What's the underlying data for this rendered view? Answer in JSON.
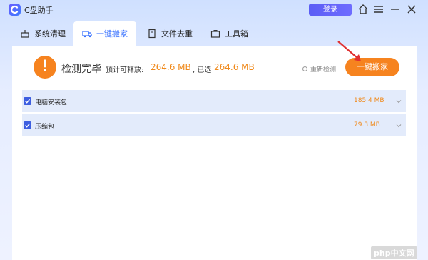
{
  "app": {
    "title": "C盘助手",
    "login_label": "登录"
  },
  "tabs": [
    {
      "label": "系统清理",
      "icon": "broom-icon"
    },
    {
      "label": "一键搬家",
      "icon": "truck-icon",
      "active": true
    },
    {
      "label": "文件去重",
      "icon": "file-icon"
    },
    {
      "label": "工具箱",
      "icon": "toolbox-icon"
    }
  ],
  "banner": {
    "status": "检测完毕",
    "release_label": "预计可释放:",
    "release_value": "264.6 MB",
    "selected_label": ", 已选",
    "selected_value": "264.6 MB",
    "rescan_label": "重新检测",
    "onekey_label": "一键搬家"
  },
  "items": [
    {
      "name": "电脑安装包",
      "size": "185.4 MB",
      "checked": true
    },
    {
      "name": "压缩包",
      "size": "79.3 MB",
      "checked": true
    }
  ],
  "watermark": "php中文网",
  "colors": {
    "accent": "#f6831f",
    "primary": "#2f6bff",
    "row_bg": "#e3ebfb"
  }
}
